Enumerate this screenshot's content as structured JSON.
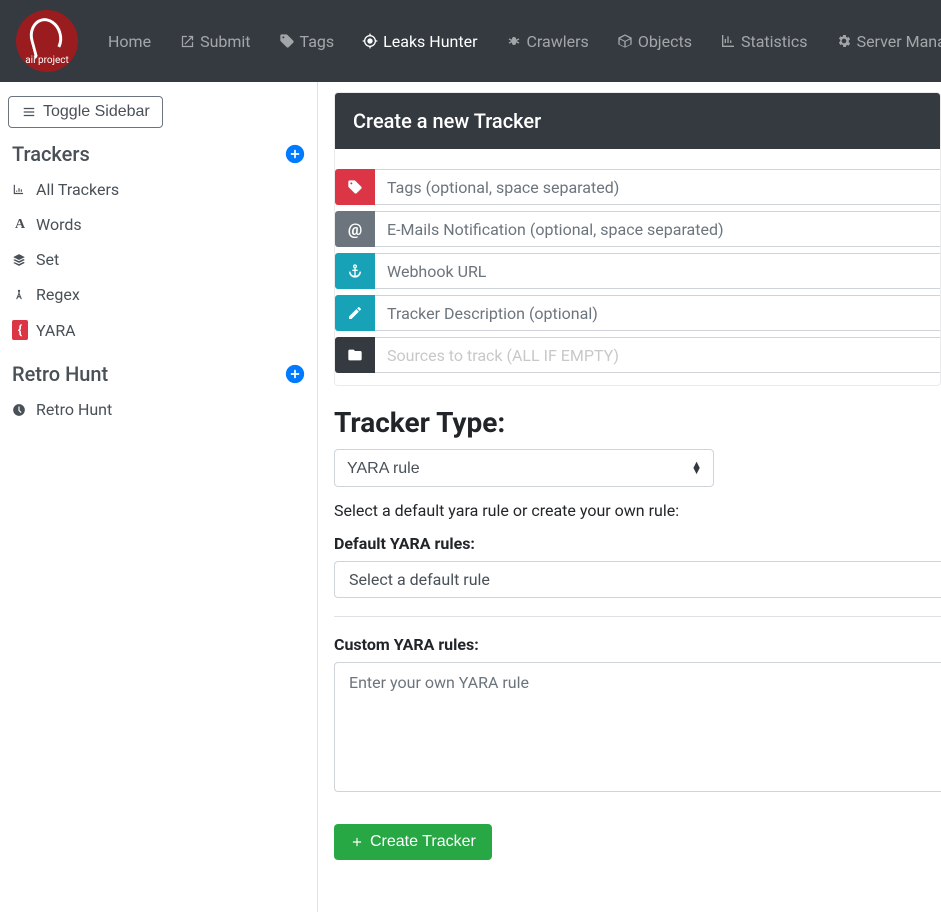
{
  "logo_text": "ail project",
  "nav": {
    "home": "Home",
    "submit": "Submit",
    "tags": "Tags",
    "leaks_hunter": "Leaks Hunter",
    "crawlers": "Crawlers",
    "objects": "Objects",
    "statistics": "Statistics",
    "server_management": "Server Management"
  },
  "sidebar": {
    "toggle": "Toggle Sidebar",
    "trackers_title": "Trackers",
    "retro_title": "Retro Hunt",
    "items": {
      "all_trackers": "All Trackers",
      "words": "Words",
      "set": "Set",
      "regex": "Regex",
      "yara": "YARA",
      "retro_hunt": "Retro Hunt"
    }
  },
  "form": {
    "header": "Create a new Tracker",
    "tags_ph": "Tags (optional, space separated)",
    "emails_ph": "E-Mails Notification (optional, space separated)",
    "webhook_ph": "Webhook URL",
    "desc_ph": "Tracker Description (optional)",
    "sources_ph": "Sources to track (ALL IF EMPTY)",
    "type_heading": "Tracker Type:",
    "type_selected": "YARA rule",
    "help": "Select a default yara rule or create your own rule:",
    "default_label": "Default YARA rules:",
    "default_selected": "Select a default rule",
    "custom_label": "Custom YARA rules:",
    "custom_ph": "Enter your own YARA rule",
    "submit": "Create Tracker"
  }
}
